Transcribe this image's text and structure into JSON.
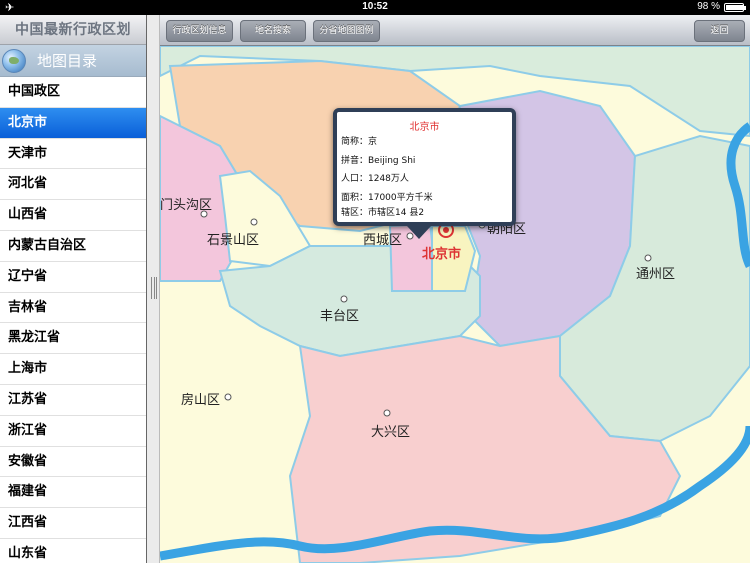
{
  "status_bar": {
    "time": "10:52",
    "battery": "98 %",
    "battery_level": 0.98
  },
  "sidebar": {
    "title": "中国最新行政区划",
    "section_header": "地图目录",
    "items": [
      "中国政区",
      "北京市",
      "天津市",
      "河北省",
      "山西省",
      "内蒙古自治区",
      "辽宁省",
      "吉林省",
      "黑龙江省",
      "上海市",
      "江苏省",
      "浙江省",
      "安徽省",
      "福建省",
      "江西省",
      "山东省"
    ],
    "selected": "北京市"
  },
  "toolbar": {
    "btn_info": "行政区划信息",
    "btn_search": "地名搜索",
    "btn_legend": "分省地图图例",
    "btn_back": "返回"
  },
  "map": {
    "places": {
      "mentougou": "门头沟区",
      "shijingshan": "石景山区",
      "xicheng": "西城区",
      "chaoyang": "朝阳区",
      "beijing": "北京市",
      "tongzhou": "通州区",
      "fengtai": "丰台区",
      "fangshan": "房山区",
      "daxing": "大兴区"
    },
    "colors": {
      "background": "#fdfbdc",
      "mentougou": "#f3c6dc",
      "haidian": "#f8d2b0",
      "changping": "#d9ecdc",
      "chaoyang": "#d3c5e6",
      "tongzhou": "#d7eadb",
      "fengtai": "#d5eadf",
      "daxing": "#f8cfcf",
      "xicheng": "#f3c6dc",
      "dongcheng": "#f8f4c0",
      "river": "#3aa3e3",
      "capital_label": "#e03030"
    }
  },
  "callout": {
    "title": "北京市",
    "abbr": "简称：京",
    "pinyin": "拼音：Beijing Shi",
    "population": "人口：1248万人",
    "area": "面积：17000平方千米",
    "districts": "辖区：市辖区14 县2"
  }
}
